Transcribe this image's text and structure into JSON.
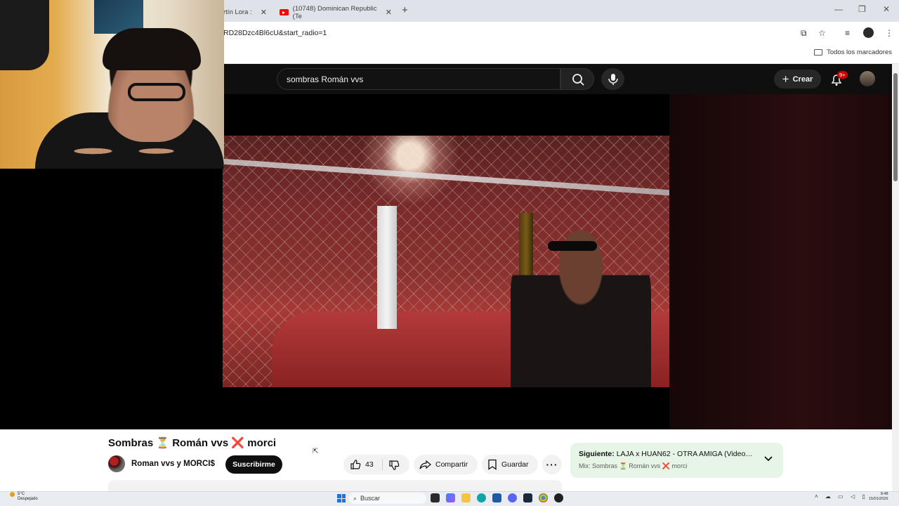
{
  "browser": {
    "tabs": [
      {
        "label": "rtín Lora :",
        "close": "✕"
      },
      {
        "label": "(10748) Dominican Republic (Te",
        "close": "✕"
      }
    ],
    "new_tab": "+",
    "window_controls": {
      "minimize": "—",
      "maximize": "❐",
      "close": "✕"
    },
    "url": "RD28Dzc4Bl6cU&start_radio=1",
    "bookmarks_label": "Todos los marcadores"
  },
  "youtube": {
    "search_value": "sombras Román vvs",
    "create_label": "Crear",
    "notif_badge": "9+",
    "video": {
      "title": "Sombras ⏳ Román vvs ❌ morci",
      "channel": "Roman vvs y MORCI$",
      "subscribe_label": "Suscribirme",
      "likes": "43",
      "share_label": "Compartir",
      "save_label": "Guardar"
    },
    "up_next": {
      "prefix": "Siguiente:",
      "title": "LAJA x HUAN62 - OTRA AMIGA (Video O...",
      "mix": "Mix: Sombras ⏳ Román vvs ❌ morci"
    }
  },
  "taskbar": {
    "weather_temp": "5°C",
    "weather_desc": "Despejado",
    "search_placeholder": "Buscar",
    "time": "8:48",
    "date": "15/01/2026"
  }
}
